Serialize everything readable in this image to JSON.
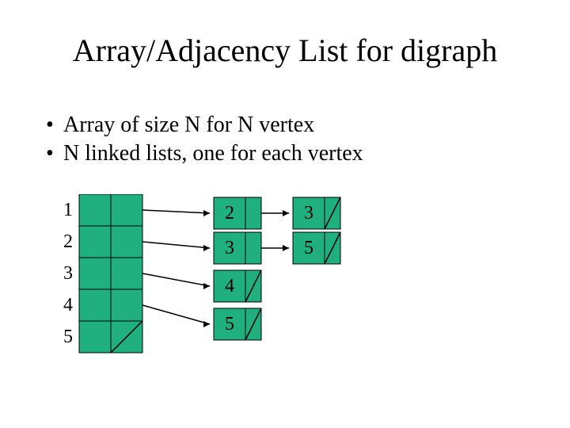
{
  "title": "Array/Adjacency List for digraph",
  "bullets": [
    "Array of size N for N vertex",
    "N linked lists, one for each vertex"
  ],
  "array_indices": [
    "1",
    "2",
    "3",
    "4",
    "5"
  ],
  "lists": {
    "row1": [
      "2",
      "3"
    ],
    "row2": [
      "3",
      "5"
    ],
    "row3": [
      "4"
    ],
    "row4": [
      "5"
    ]
  },
  "colors": {
    "cell_fill": "#20b080",
    "cell_stroke": "#000000"
  }
}
